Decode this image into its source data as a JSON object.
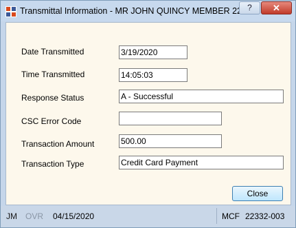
{
  "window": {
    "title": "Transmittal Information - MR JOHN QUINCY MEMBER 22...",
    "help_label": "?",
    "close_label": "✕"
  },
  "form": {
    "date_transmitted": {
      "label": "Date Transmitted",
      "value": "3/19/2020"
    },
    "time_transmitted": {
      "label": "Time Transmitted",
      "value": "14:05:03"
    },
    "response_status": {
      "label": "Response Status",
      "value": "A - Successful"
    },
    "csc_error_code": {
      "label": "CSC Error Code",
      "value": ""
    },
    "transaction_amount": {
      "label": "Transaction Amount",
      "value": "500.00"
    },
    "transaction_type": {
      "label": "Transaction Type",
      "value": "Credit Card Payment"
    }
  },
  "buttons": {
    "close_label": "Close"
  },
  "statusbar": {
    "user": "JM",
    "mode": "OVR",
    "date": "04/15/2020",
    "system": "MCF",
    "code": "22332-003"
  },
  "colors": {
    "client_bg": "#fdf8ec",
    "frame": "#c5d6ea",
    "close_button": "#c13b2a"
  }
}
